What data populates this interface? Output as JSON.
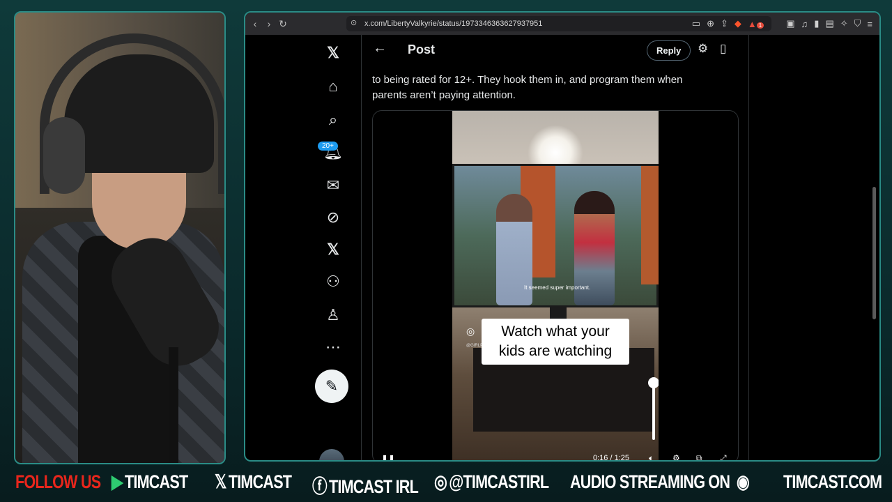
{
  "browser": {
    "url": "x.com/LibertyValkyrie/status/1973346363627937951",
    "nav_back": "‹",
    "nav_forward": "›",
    "nav_reload": "↻",
    "extension_badge": "1"
  },
  "x_nav": {
    "notifications_badge": "20+"
  },
  "post": {
    "header_title": "Post",
    "reply_label": "Reply",
    "text_line1": "to being rated for 12+.  They hook them in, and program them when",
    "text_line2": "parents aren’t paying attention."
  },
  "video": {
    "subtitle": "It seemed super important.",
    "overlay_line1": "Watch what your",
    "overlay_line2": "kids are watching",
    "ig_handle": "@GIRLP...",
    "timecode": "0:16 / 1:25",
    "volume_level": 1.0
  },
  "ticker": {
    "follow": "FOLLOW US",
    "youtube": "TIMCAST",
    "x": "TIMCAST",
    "facebook": "TIMCAST IRL",
    "instagram": "@TIMCASTIRL",
    "audio": "AUDIO STREAMING ON",
    "site": "TIMCAST.COM"
  },
  "colors": {
    "accent": "#1d9bf0",
    "follow_red": "#e8261c",
    "frame_teal": "#2a8c86"
  }
}
